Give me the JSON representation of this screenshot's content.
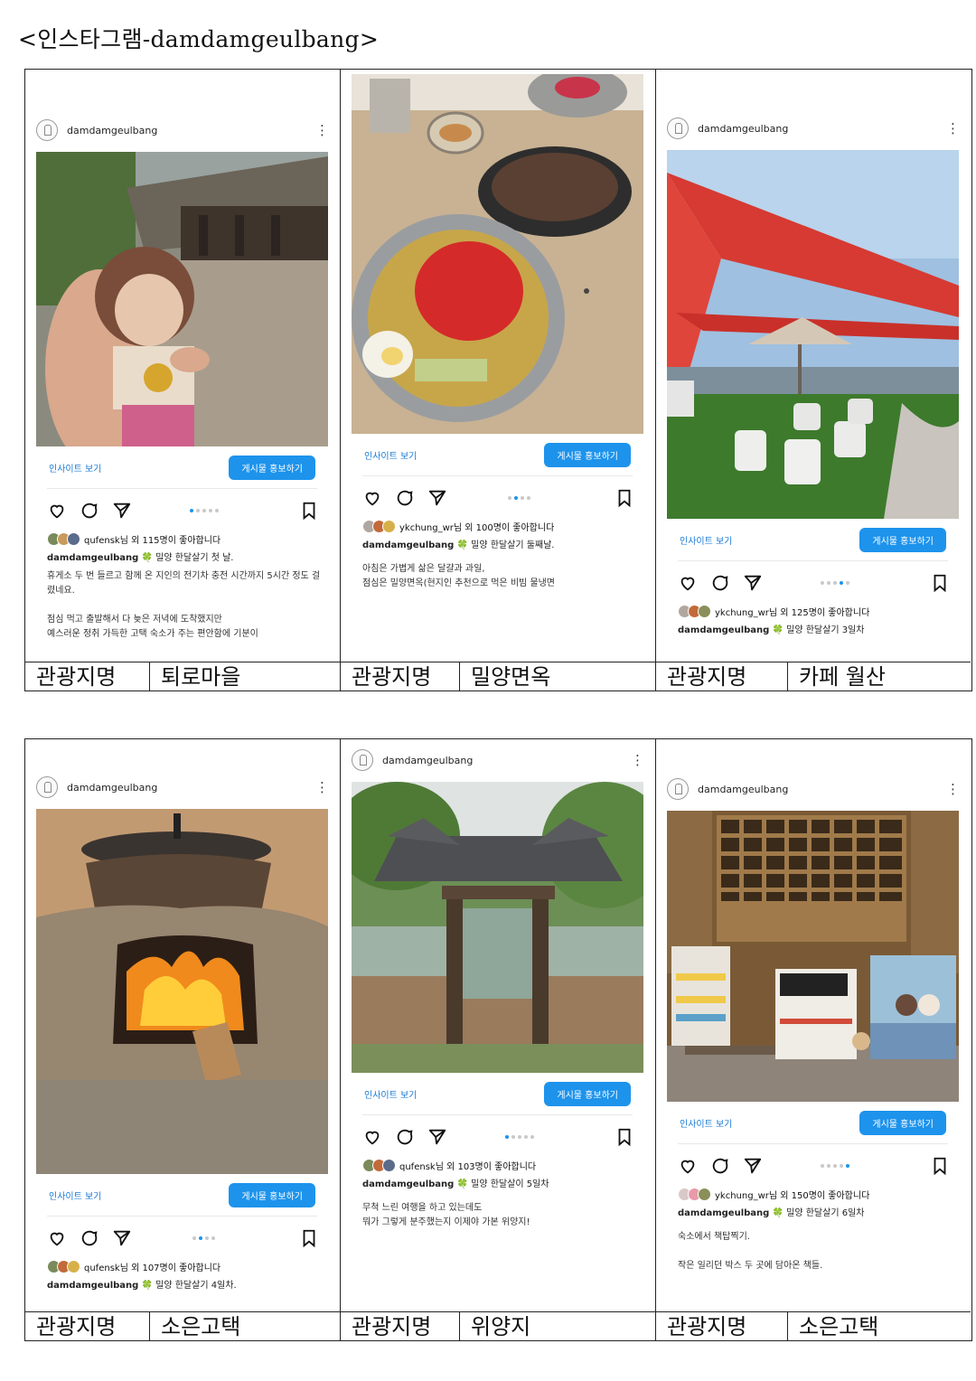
{
  "page_title": "<인스타그램-damdamgeulbang>",
  "posts": [
    {
      "username": "damdamgeulbang",
      "likes": "qufensk님 외 115명이 좋아합니다",
      "caption_user": "damdamgeulbang",
      "caption": "밀양 한달살기 첫 날.",
      "body": "휴게소 두 번 들르고 함께 온 지인의 전기차 충전 시간까지 5시간 정도 걸렸네요.\n\n점심 먹고 출발해서 다 늦은 저녁에 도착했지만\n예스러운 정취 가득한 고택 숙소가 주는 편안함에 기분이",
      "insight": "인사이트 보기",
      "promote": "게시물 홍보하기",
      "label_key": "관광지명",
      "label_value": "퇴로마을",
      "dots_active": 0
    },
    {
      "username": "",
      "likes": "ykchung_wr님 외 100명이 좋아합니다",
      "caption_user": "damdamgeulbang",
      "caption": "밀양 한달살기 둘째날.",
      "body": "아침은 가볍게 삶은 달걀과 과일,\n점심은 밀양면옥(현지인 추천으로 먹은 비빔 물냉면",
      "insight": "인사이트 보기",
      "promote": "게시물 홍보하기",
      "label_key": "관광지명",
      "label_value": "밀양면옥",
      "dots_active": 1
    },
    {
      "username": "damdamgeulbang",
      "likes": "ykchung_wr님 외 125명이 좋아합니다",
      "caption_user": "damdamgeulbang",
      "caption": "밀양 한달살기 3일차",
      "body": "",
      "insight": "인사이트 보기",
      "promote": "게시물 홍보하기",
      "label_key": "관광지명",
      "label_value": "카페 월산",
      "dots_active": 3
    },
    {
      "username": "damdamgeulbang",
      "likes": "qufensk님 외 107명이 좋아합니다",
      "caption_user": "damdamgeulbang",
      "caption": "밀양 한달살기 4일차.",
      "body": "",
      "insight": "인사이트 보기",
      "promote": "게시물 홍보하기",
      "label_key": "관광지명",
      "label_value": "소은고택",
      "dots_active": 1
    },
    {
      "username": "damdamgeulbang",
      "likes": "qufensk님 외 103명이 좋아합니다",
      "caption_user": "damdamgeulbang",
      "caption": "밀양 한달살이 5일차",
      "body": "무척 느린 여행을 하고 있는데도\n뭐가 그렇게 분주했는지 이제야 가본 위양지!",
      "insight": "인사이트 보기",
      "promote": "게시물 홍보하기",
      "label_key": "관광지명",
      "label_value": "위양지",
      "dots_active": 0
    },
    {
      "username": "damdamgeulbang",
      "likes": "ykchung_wr님 외 150명이 좋아합니다",
      "caption_user": "damdamgeulbang",
      "caption": "밀양 한달살기 6일차",
      "body": "숙소에서 책탑찍기.\n\n작은 일리던 박스 두 곳에 담아온 책들.",
      "insight": "인사이트 보기",
      "promote": "게시물 홍보하기",
      "label_key": "관광지명",
      "label_value": "소은고택",
      "dots_active": 4
    }
  ],
  "colors": {
    "accent": "#1d93ec",
    "link": "#1a7bd6"
  }
}
